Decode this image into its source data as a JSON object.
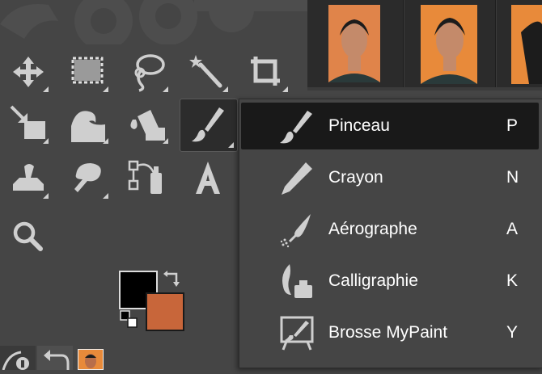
{
  "toolbox": {
    "tools": [
      {
        "icon": "move-icon"
      },
      {
        "icon": "rect-select-icon"
      },
      {
        "icon": "lasso-icon"
      },
      {
        "icon": "fuzzy-select-icon"
      },
      {
        "icon": "crop-icon"
      },
      {
        "icon": "unified-transform-icon"
      },
      {
        "icon": "warp-icon"
      },
      {
        "icon": "bucket-fill-icon"
      },
      {
        "icon": "paintbrush-icon"
      },
      {
        "icon": "clone-icon"
      },
      {
        "icon": "smudge-icon"
      },
      {
        "icon": "paths-icon"
      },
      {
        "icon": "text-icon"
      },
      {
        "icon": "zoom-icon"
      }
    ],
    "foreground_color": "#000000",
    "background_color": "#c8663a"
  },
  "brush_menu": {
    "items": [
      {
        "label": "Pinceau",
        "shortcut": "P",
        "icon": "paintbrush-icon",
        "selected": true
      },
      {
        "label": "Crayon",
        "shortcut": "N",
        "icon": "pencil-icon",
        "selected": false
      },
      {
        "label": "Aérographe",
        "shortcut": "A",
        "icon": "airbrush-icon",
        "selected": false
      },
      {
        "label": "Calligraphie",
        "shortcut": "K",
        "icon": "ink-icon",
        "selected": false
      },
      {
        "label": "Brosse MyPaint",
        "shortcut": "Y",
        "icon": "mypaint-brush-icon",
        "selected": false
      }
    ]
  },
  "colors": {
    "accent_orange": "#c8663a",
    "menu_selected": "#191919",
    "icon_gray": "#cfcfcf"
  }
}
